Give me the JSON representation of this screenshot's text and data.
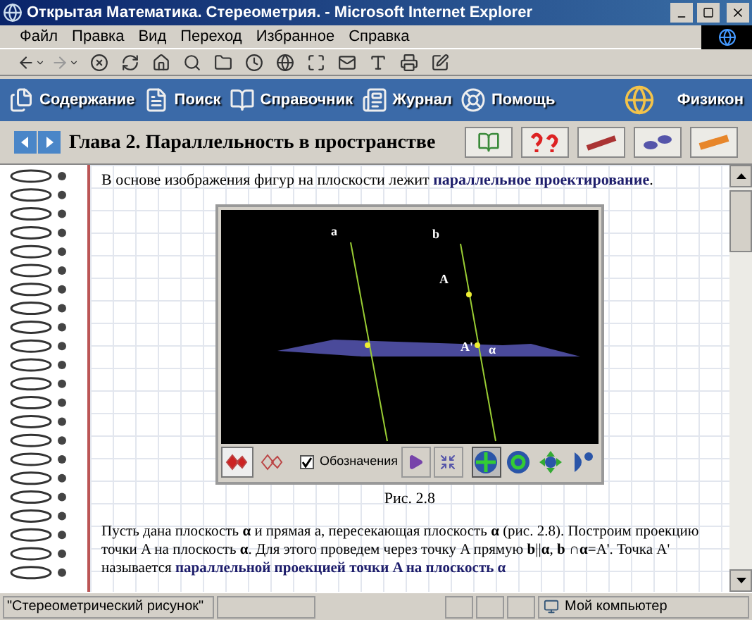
{
  "window": {
    "title": "Открытая Математика. Стереометрия. - Microsoft Internet Explorer"
  },
  "menu": [
    "Файл",
    "Правка",
    "Вид",
    "Переход",
    "Избранное",
    "Справка"
  ],
  "nav": [
    {
      "label": "Содержание",
      "kind": "contents"
    },
    {
      "label": "Поиск",
      "kind": "search"
    },
    {
      "label": "Справочник",
      "kind": "book"
    },
    {
      "label": "Журнал",
      "kind": "journal"
    },
    {
      "label": "Помощь",
      "kind": "help"
    }
  ],
  "brand": "Физикон",
  "chapter": {
    "title": "Глава 2. Параллельность в пространстве"
  },
  "intro": "В основе изображения фигур на плоскости лежит **параллельное проектирование**.",
  "figure": {
    "point_labels": [
      "a",
      "b",
      "A",
      "A'",
      "α"
    ],
    "view_modes": [
      {
        "selected": true
      },
      {
        "selected": false
      }
    ],
    "show_labels": {
      "label": "Обозначения",
      "checked": true
    },
    "tools": [
      {
        "kind": "move",
        "selected": true
      },
      {
        "kind": "rotate",
        "selected": false
      },
      {
        "kind": "pan",
        "selected": false
      },
      {
        "kind": "zoom",
        "selected": false
      }
    ],
    "caption": "Рис. 2.8"
  },
  "paragraph": {
    "text": "Пусть дана плоскость **α** и прямая a, пересекающая плоскость **α** (рис. 2.8). Построим проекцию точки A на плоскость **α**. Для этого проведем через точку A прямую **b**||**α**, **b** ∩**α**=A'. Точка A' называется ",
    "link": "параллельной проекцией точки A на плоскость α"
  },
  "status_bar": {
    "text": "\"Стереометрический рисунок\"",
    "zone": "Мой компьютер"
  }
}
